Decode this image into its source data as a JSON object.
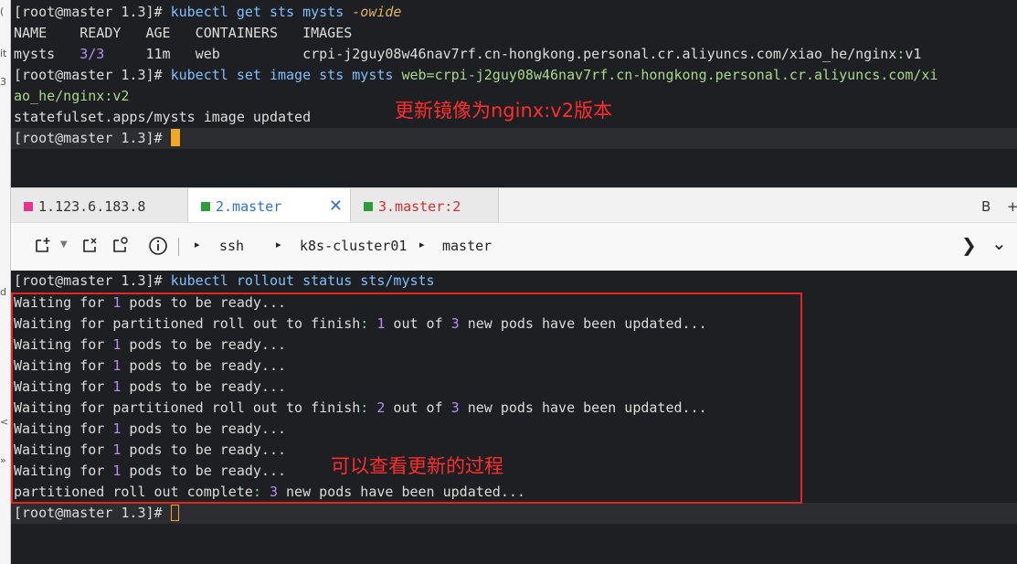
{
  "left_margin": {
    "labels": [
      "(",
      "it",
      "3",
      "d",
      "<",
      "»"
    ]
  },
  "top_terminal": {
    "prompt": "[root@master 1.3]",
    "hash": "#",
    "cmd1": {
      "command": "kubectl get sts mysts",
      "option": "-owide"
    },
    "table_header": "NAME    READY   AGE   CONTAINERS   IMAGES",
    "row": {
      "name": "mysts",
      "ready": "3/3",
      "age": "11m",
      "containers": "web",
      "image_host": "crpi-j2guy08w46nav7rf.cn-hongkong.personal.cr.aliyuncs.com/xiao_he/nginx",
      "image_tag": "v1"
    },
    "cmd2": {
      "command": "kubectl set image sts mysts",
      "arg_line1": "web=crpi-j2guy08w46nav7rf.cn-hongkong.personal.cr.aliyuncs.com/xi",
      "arg_line2_a": "ao_he/nginx",
      "arg_line2_b": "v2"
    },
    "output": "statefulset.apps/mysts image updated",
    "annotation": "更新镜像为nginx:v2版本"
  },
  "tabs": {
    "tab1": {
      "label": "1.123.6.183.8",
      "color": "#e8338f"
    },
    "tab2": {
      "label": "2.master",
      "color": "#2c9c3c",
      "close": "✕"
    },
    "tab3": {
      "label": "3.master:2",
      "color": "#2c9c3c"
    },
    "right_label": "B",
    "plus": "+"
  },
  "toolbar": {
    "icons": [
      "new-tab-icon",
      "dropdown-icon",
      "close-tab-icon",
      "duplicate-tab-icon",
      "info-icon"
    ],
    "breadcrumb": [
      "ssh",
      "k8s-cluster01",
      "master"
    ],
    "nav_next": "❯",
    "nav_down": "⌄"
  },
  "bottom_terminal": {
    "cmd": "kubectl rollout status sts/mysts",
    "wait_a": "Waiting for ",
    "wait_b": " pods to be ready...",
    "wait_num": "1",
    "part_a": "Waiting for partitioned roll out to finish",
    "part_b": " out of ",
    "part_c": " new pods have been updated...",
    "part1_num": "1",
    "part2_num": "2",
    "total": "3",
    "complete_a": "partitioned roll out complete",
    "complete_b": " new pods have been updated...",
    "annotation": "可以查看更新的过程"
  }
}
